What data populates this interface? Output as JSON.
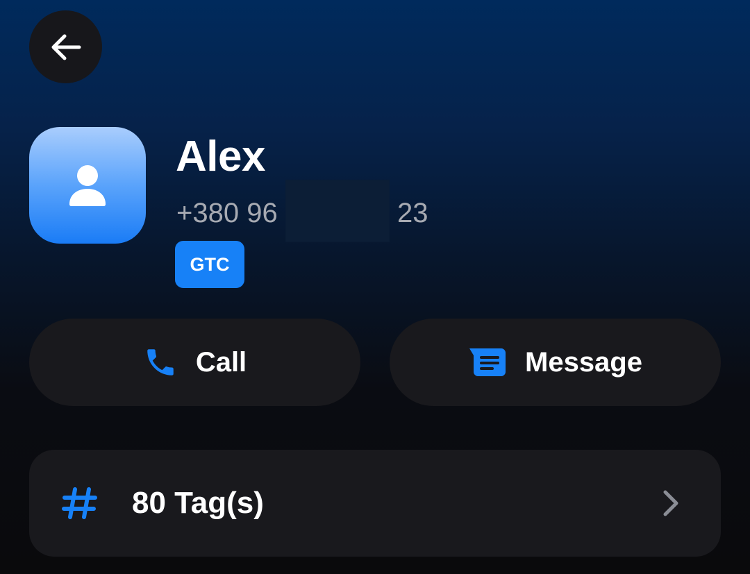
{
  "contact": {
    "name": "Alex",
    "phone_start": "+380 96",
    "phone_end": "23",
    "tag_badge": "GTC"
  },
  "actions": {
    "call_label": "Call",
    "message_label": "Message"
  },
  "tags": {
    "label": "80 Tag(s)"
  },
  "icons": {
    "back": "arrow-left-icon",
    "avatar": "person-icon",
    "call": "phone-icon",
    "message": "message-icon",
    "tags": "hash-icon",
    "chevron": "chevron-right-icon"
  },
  "colors": {
    "accent": "#1781f7",
    "card": "#19191d",
    "secondary_text": "#a7aab2"
  }
}
